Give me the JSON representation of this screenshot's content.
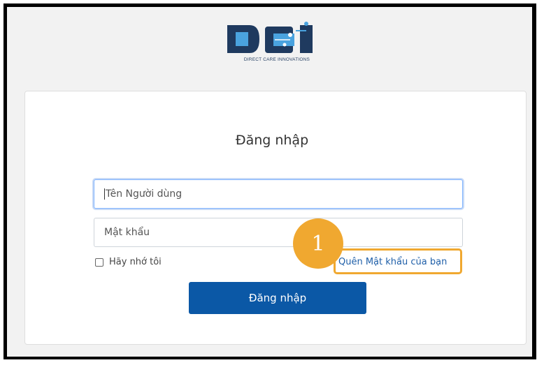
{
  "brand": {
    "logo_text": "DIRECT CARE INNOVATIONS",
    "colors": {
      "dark": "#1f3a5f",
      "light": "#4aa3df"
    }
  },
  "login": {
    "title": "Đăng nhập",
    "username_placeholder": "Tên Người dùng",
    "password_placeholder": "Mật khẩu",
    "remember_label": "Hãy nhớ tôi",
    "forgot_label": "Quên Mật khẩu của bạn",
    "submit_label": "Đăng nhập"
  },
  "annotation": {
    "step_number": "1",
    "color": "#f0a830"
  },
  "colors": {
    "primary_button": "#0b58a6",
    "link": "#1f5fa8"
  }
}
